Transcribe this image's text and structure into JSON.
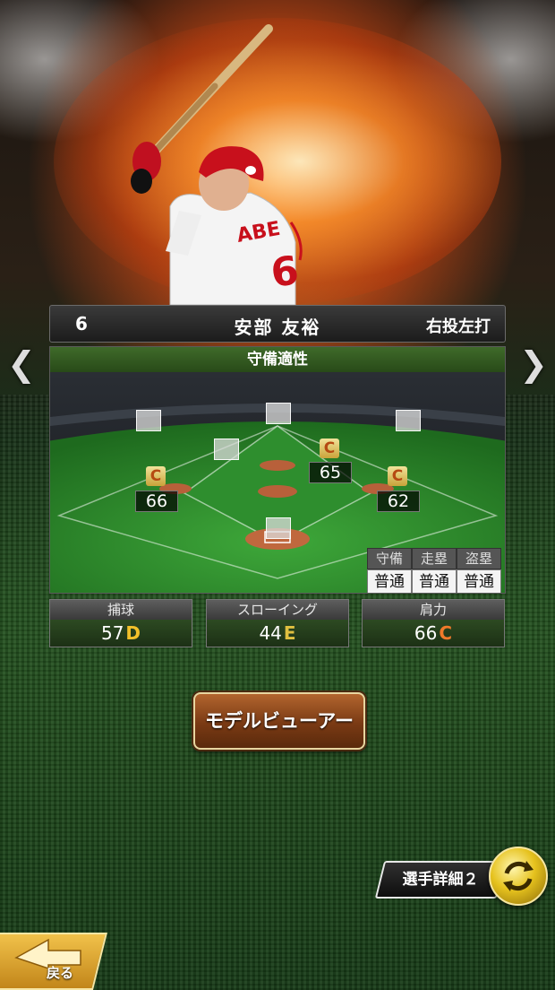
{
  "header": {
    "uniform_number": "6",
    "player_name": "安部 友裕",
    "throw_bat": "右投左打"
  },
  "field": {
    "title": "守備適性",
    "positions": [
      {
        "rank": "C",
        "value": "66"
      },
      {
        "rank": "C",
        "value": "65"
      },
      {
        "rank": "C",
        "value": "62"
      }
    ],
    "stats": [
      {
        "label": "守備",
        "value": "普通"
      },
      {
        "label": "走塁",
        "value": "普通"
      },
      {
        "label": "盗塁",
        "value": "普通"
      }
    ]
  },
  "abilities": [
    {
      "label": "捕球",
      "value": "57",
      "grade": "D",
      "grade_color": "#f2c02a"
    },
    {
      "label": "スローイング",
      "value": "44",
      "grade": "E",
      "grade_color": "#e0c040"
    },
    {
      "label": "肩力",
      "value": "66",
      "grade": "C",
      "grade_color": "#f07a2a"
    }
  ],
  "buttons": {
    "model_viewer": "モデルビューアー",
    "player_detail": "選手詳細２",
    "back": "戻る"
  },
  "icons": {
    "left_arrow": "chevron-left-icon",
    "right_arrow": "chevron-right-icon",
    "swap": "refresh-swap-icon",
    "back": "back-arrow-icon"
  },
  "uniform_text": "ABE"
}
